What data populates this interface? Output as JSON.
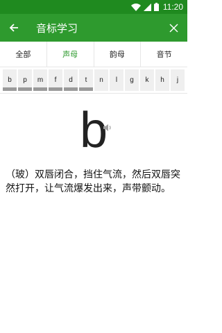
{
  "status": {
    "time": "11:20"
  },
  "header": {
    "title": "音标学习"
  },
  "tabs": [
    {
      "label": "全部"
    },
    {
      "label": "声母"
    },
    {
      "label": "韵母"
    },
    {
      "label": "音节"
    }
  ],
  "letters": [
    "b",
    "p",
    "m",
    "f",
    "d",
    "t",
    "n",
    "l",
    "g",
    "k",
    "h",
    "j"
  ],
  "current": {
    "letter": "b",
    "description": "（玻）双唇闭合，挡住气流，然后双唇突然打开，让气流爆发出来，声带颤动。"
  },
  "colors": {
    "primary": "#2e9a2e",
    "status_bar": "#1f8a1f",
    "active_tab": "#2e9a2e"
  },
  "icons": [
    "wifi-icon",
    "signal-icon",
    "battery-icon",
    "back-arrow-icon",
    "close-icon",
    "speaker-icon"
  ]
}
